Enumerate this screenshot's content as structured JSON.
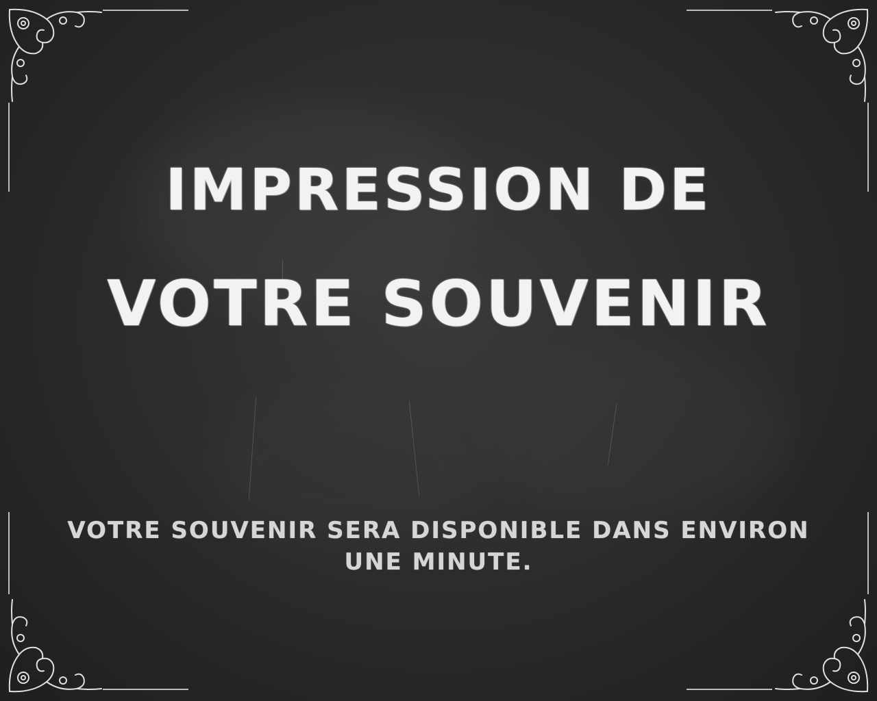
{
  "title": {
    "line1": "impression de",
    "line2": "votre souvenir"
  },
  "message": {
    "line1": "votre souvenir sera disponible dans environ",
    "line2": "une minute."
  },
  "colors": {
    "background": "#2a2a2a",
    "chalk": "#f2f2f2",
    "chalk_dim": "#d6d6d6"
  }
}
